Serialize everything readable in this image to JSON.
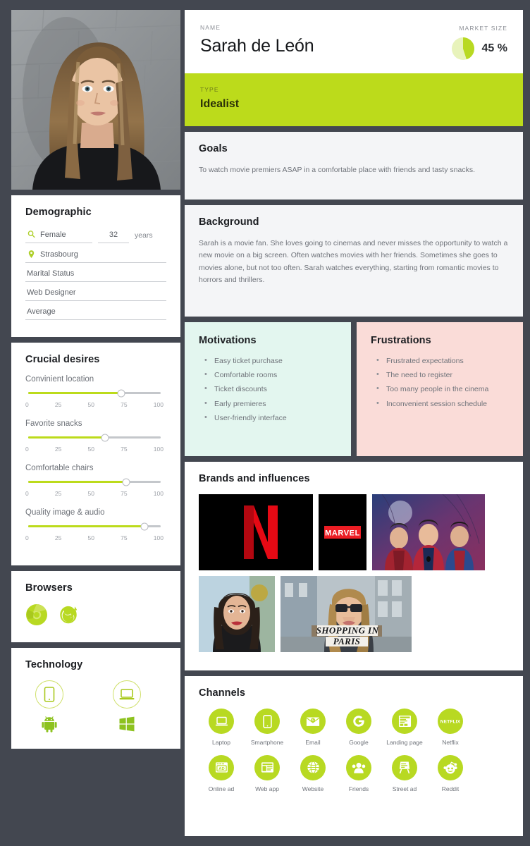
{
  "colors": {
    "accent_green": "#BCDB1B",
    "page_background": "#434750",
    "card_background": "#FFFFFF",
    "soft_panel": "#F4F5F7",
    "motivations_background": "#E3F6EF",
    "frustrations_background": "#FADCD8"
  },
  "photo": {
    "alt_name": "persona-portrait"
  },
  "header": {
    "name_label": "NAME",
    "name_value": "Sarah de León",
    "market_size_label": "MARKET SIZE",
    "market_size_value": "45 %",
    "market_size_percent": 45,
    "type_label": "TYPE",
    "type_value": "Idealist"
  },
  "goals": {
    "title": "Goals",
    "text": "To watch movie premiers ASAP in a comfortable place with friends and tasty snacks."
  },
  "background": {
    "title": "Background",
    "text": "Sarah is a movie fan. She loves going to cinemas and never misses the opportunity to watch a new movie on a big screen. Often watches movies with her friends. Sometimes she goes to movies alone, but not too often. Sarah watches everything, starting from romantic movies to horrors and thrillers."
  },
  "motivations": {
    "title": "Motivations",
    "items": [
      "Easy ticket purchase",
      "Comfortable rooms",
      "Ticket discounts",
      "Early premieres",
      "User-friendly interface"
    ]
  },
  "frustrations": {
    "title": "Frustrations",
    "items": [
      "Frustrated expectations",
      "The need to register",
      "Too many people in the cinema",
      "Inconvenient session schedule"
    ]
  },
  "demographic": {
    "title": "Demographic",
    "gender": "Female",
    "gender_icon": "female-symbol-icon",
    "age": "32",
    "age_units": "years",
    "city": "Strasbourg",
    "city_icon": "location-pin-icon",
    "marital_status": "Marital Status",
    "occupation": "Web Designer",
    "income": "Average"
  },
  "crucial_desires": {
    "title": "Crucial desires",
    "tick_labels": [
      "0",
      "25",
      "50",
      "75",
      "100"
    ],
    "sliders": [
      {
        "label": "Convinient location",
        "value": 70
      },
      {
        "label": "Favorite snacks",
        "value": 58
      },
      {
        "label": "Comfortable chairs",
        "value": 74
      },
      {
        "label": "Quality image & audio",
        "value": 88
      }
    ]
  },
  "browsers": {
    "title": "Browsers",
    "items": [
      {
        "name": "chrome-icon",
        "label": "Chrome"
      },
      {
        "name": "firefox-icon",
        "label": "Firefox"
      }
    ]
  },
  "technology": {
    "title": "Technology",
    "items": [
      {
        "device_icon": "smartphone-icon",
        "os_icon": "android-icon"
      },
      {
        "device_icon": "laptop-icon",
        "os_icon": "windows-icon"
      }
    ]
  },
  "brands": {
    "title": "Brands and influences",
    "row1": [
      {
        "name": "netflix-logo-tile",
        "label": "Netflix"
      },
      {
        "name": "marvel-logo-tile",
        "label": "MARVEL"
      },
      {
        "name": "spiderman-poster-tile",
        "label": "Spider-Man"
      }
    ],
    "row2": [
      {
        "name": "celebrity-portrait-tile",
        "label": "Celebrity"
      },
      {
        "name": "shopping-vlog-tile",
        "label": "SHOPPING IN PARIS"
      }
    ]
  },
  "channels": {
    "title": "Channels",
    "items": [
      {
        "icon": "laptop-icon",
        "label": "Laptop"
      },
      {
        "icon": "smartphone-icon",
        "label": "Smartphone"
      },
      {
        "icon": "email-icon",
        "label": "Email"
      },
      {
        "icon": "google-icon",
        "label": "Google"
      },
      {
        "icon": "landing-page-icon",
        "label": "Landing page"
      },
      {
        "icon": "netflix-icon",
        "label": "Netflix"
      },
      {
        "icon": "online-ad-icon",
        "label": "Online ad"
      },
      {
        "icon": "web-app-icon",
        "label": "Web app"
      },
      {
        "icon": "website-globe-icon",
        "label": "Website"
      },
      {
        "icon": "friends-icon",
        "label": "Friends"
      },
      {
        "icon": "street-ad-icon",
        "label": "Street ad"
      },
      {
        "icon": "reddit-icon",
        "label": "Reddit"
      }
    ]
  }
}
